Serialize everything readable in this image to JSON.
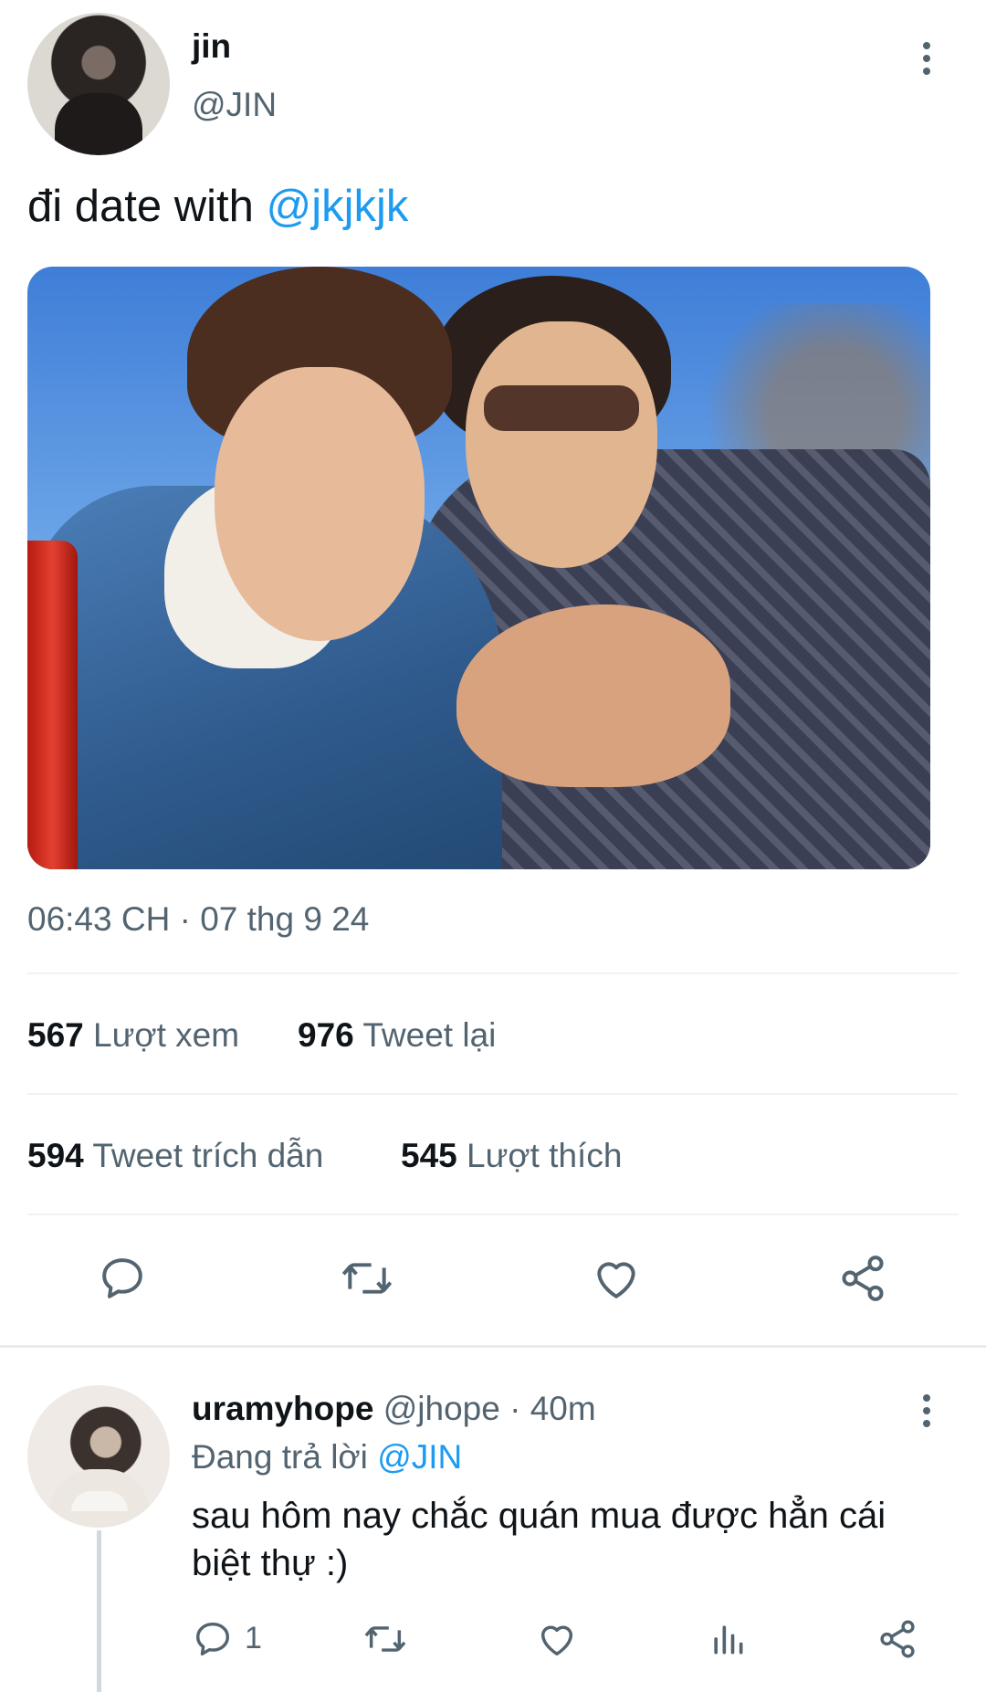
{
  "tweet": {
    "author_name": "jin",
    "author_handle": "@JIN",
    "text_prefix": "đi date with ",
    "mention": "@jkjkjk",
    "timestamp": "06:43 CH · 07 thg 9 24",
    "stats": [
      {
        "count": "567",
        "label": "Lượt xem"
      },
      {
        "count": "976",
        "label": "Tweet lại"
      },
      {
        "count": "594",
        "label": "Tweet trích dẫn"
      },
      {
        "count": "545",
        "label": "Lượt thích"
      }
    ],
    "actions": [
      "reply-icon",
      "retweet-icon",
      "like-icon",
      "share-icon"
    ]
  },
  "reply": {
    "author_name": "uramyhope",
    "author_handle": "@jhope",
    "time": "· 40m",
    "replying_prefix": "Đang trả lời",
    "replying_to": "@JIN",
    "text": "sau hôm nay chắc quán mua được hẳn cái biệt thự :)",
    "reply_count": "1",
    "actions": [
      "reply-icon",
      "retweet-icon",
      "like-icon",
      "analytics-icon",
      "share-icon"
    ]
  },
  "colors": {
    "accent": "#1d9bf0",
    "muted": "#536471",
    "text": "#0f1419",
    "divider": "#eff3f4"
  }
}
